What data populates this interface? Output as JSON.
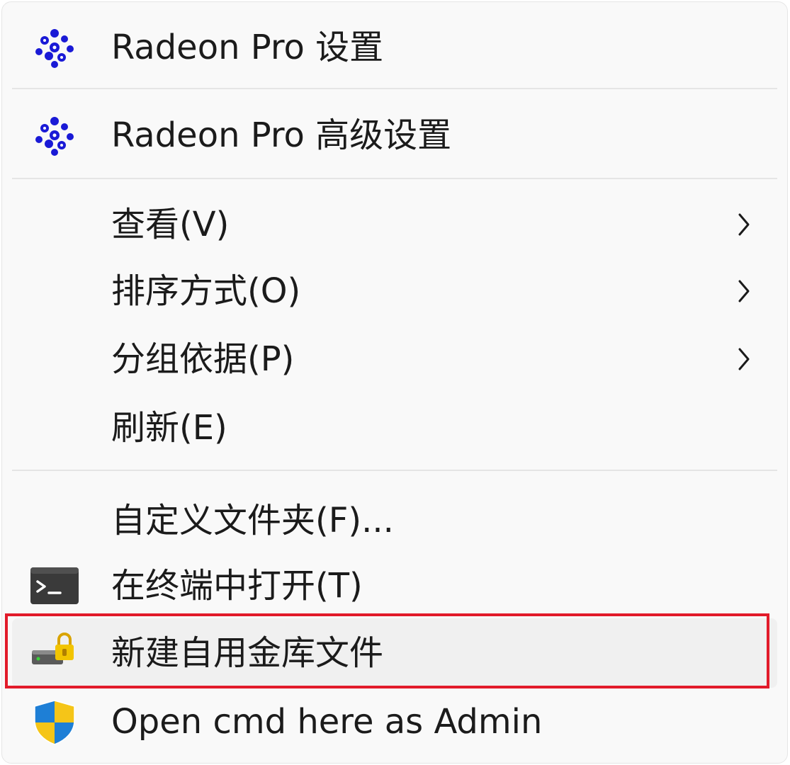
{
  "menu": {
    "items": [
      {
        "label": "Radeon Pro 设置",
        "icon": "radeon-icon"
      },
      {
        "label": "Radeon Pro 高级设置",
        "icon": "radeon-icon"
      },
      {
        "label": "查看(V)",
        "submenu": true
      },
      {
        "label": "排序方式(O)",
        "submenu": true
      },
      {
        "label": "分组依据(P)",
        "submenu": true
      },
      {
        "label": "刷新(E)"
      },
      {
        "label": "自定义文件夹(F)..."
      },
      {
        "label": "在终端中打开(T)",
        "icon": "terminal-icon"
      },
      {
        "label": "新建自用金库文件",
        "icon": "vault-lock-icon",
        "highlighted": true
      },
      {
        "label": "Open cmd here as Admin",
        "icon": "uac-shield-icon"
      }
    ]
  },
  "colors": {
    "menu_background": "#f9f9f9",
    "hover_background": "#f0f0f0",
    "highlight_border": "#e21b2a",
    "radeon_blue": "#1a1ad6"
  }
}
